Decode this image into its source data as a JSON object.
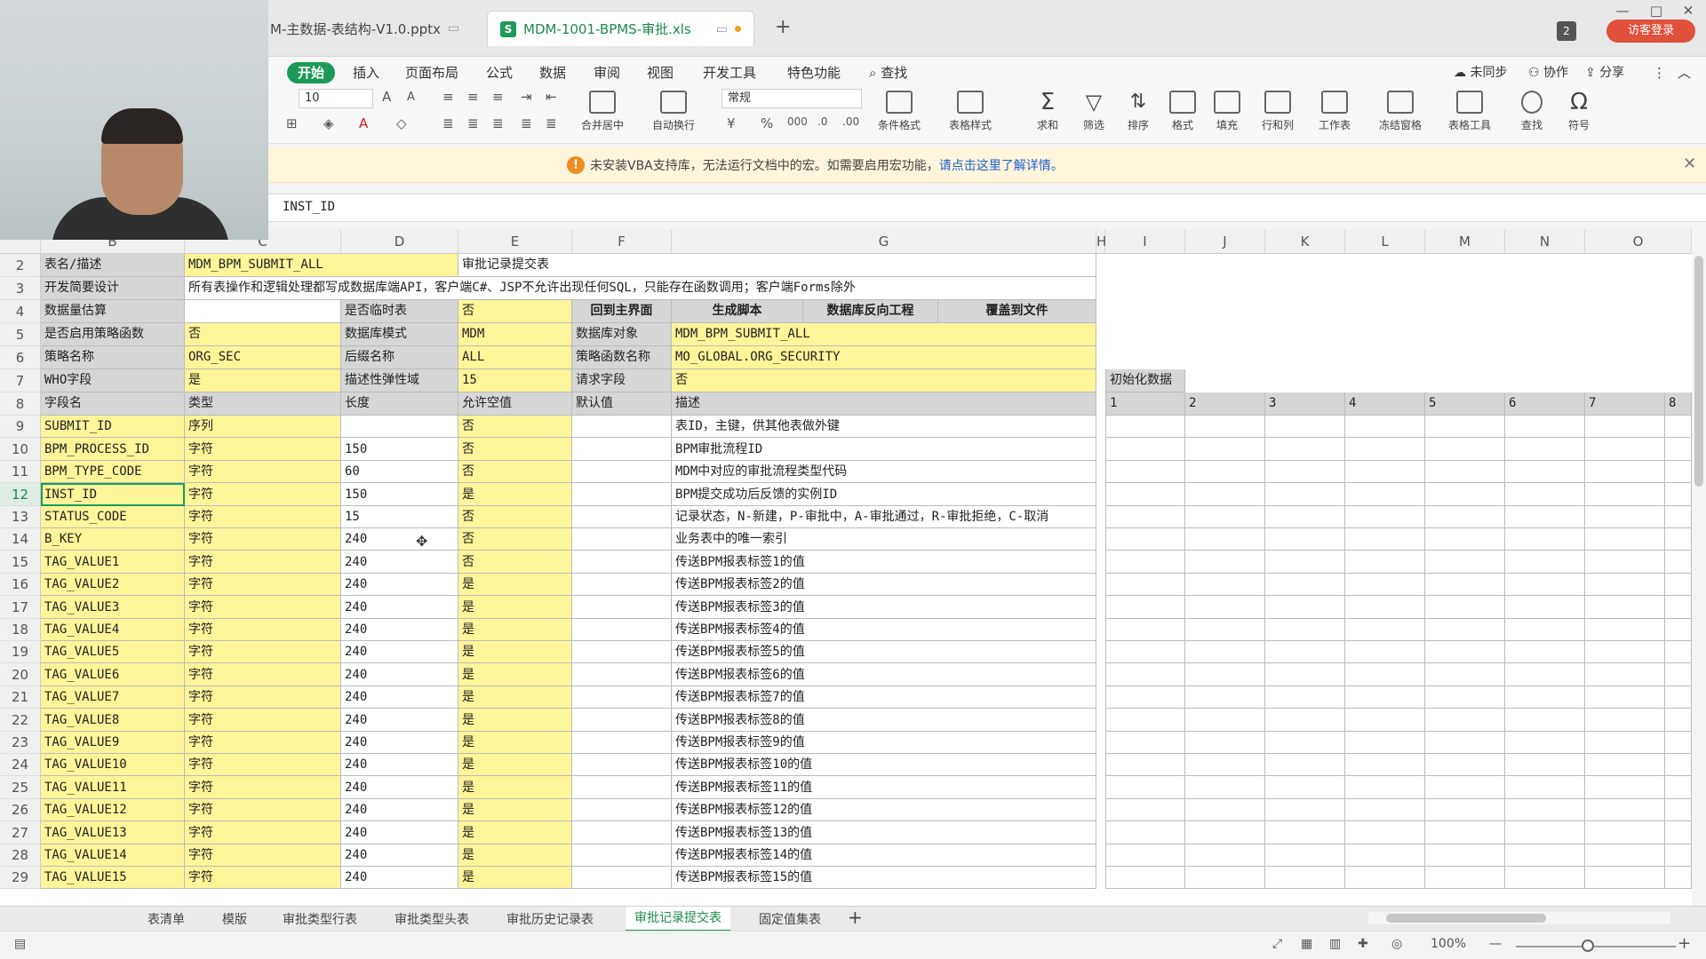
{
  "tabs": [
    {
      "label": "M-主数据-表结构-V1.0.pptx",
      "active": false
    },
    {
      "label": "MDM-1001-BPMS-审批.xls",
      "active": true
    }
  ],
  "window": {
    "badge": "2",
    "login": "访客登录"
  },
  "menu": {
    "items": [
      "开始",
      "插入",
      "页面布局",
      "公式",
      "数据",
      "审阅",
      "视图",
      "开发工具",
      "特色功能"
    ],
    "search": "查找",
    "sync": "未同步",
    "collab": "协作",
    "share": "分享"
  },
  "toolbar": {
    "font_size": "10",
    "number_format": "常规",
    "merge_label": "合并居中",
    "wrap_label": "自动换行",
    "buttons": [
      "条件格式",
      "表格样式",
      "求和",
      "筛选",
      "排序",
      "格式",
      "填充",
      "行和列",
      "工作表",
      "冻结窗格",
      "表格工具",
      "查找",
      "符号"
    ]
  },
  "notice": {
    "text": "未安装VBA支持库，无法运行文档中的宏。如需要启用宏功能，",
    "link": "请点击这里了解详情。"
  },
  "formula_bar": {
    "value": "INST_ID"
  },
  "columns": [
    "B",
    "C",
    "D",
    "E",
    "F",
    "G",
    "H",
    "I",
    "J",
    "K",
    "L",
    "M",
    "N",
    "O"
  ],
  "header_block": {
    "r2": {
      "label": "表名/描述",
      "table": "MDM_BPM_SUBMIT_ALL",
      "desc": "审批记录提交表"
    },
    "r3": {
      "label": "开发简要设计",
      "text": "所有表操作和逻辑处理都写成数据库端API，客户端C#、JSP不允许出现任何SQL，只能存在函数调用；客户端Forms除外"
    },
    "r4": {
      "label": "数据量估算",
      "tmp_label": "是否临时表",
      "tmp_val": "否",
      "btn1": "回到主界面",
      "btn2": "生成脚本",
      "btn3": "数据库反向工程",
      "btn4": "覆盖到文件"
    },
    "r5": {
      "label": "是否启用策略函数",
      "val": "否",
      "mode_label": "数据库模式",
      "mode_val": "MDM",
      "obj_label": "数据库对象",
      "obj_val": "MDM_BPM_SUBMIT_ALL"
    },
    "r6": {
      "label": "策略名称",
      "val": "ORG_SEC",
      "suffix_label": "后缀名称",
      "suffix_val": "ALL",
      "fn_label": "策略函数名称",
      "fn_val": "MO_GLOBAL.ORG_SECURITY"
    },
    "r7": {
      "label": "WHO字段",
      "val": "是",
      "flex_label": "描述性弹性域",
      "flex_val": "15",
      "req_label": "请求字段",
      "req_val": "否",
      "init_label": "初始化数据"
    },
    "r8": {
      "h1": "字段名",
      "h2": "类型",
      "h3": "长度",
      "h4": "允许空值",
      "h5": "默认值",
      "h6": "描述",
      "nums": [
        "1",
        "2",
        "3",
        "4",
        "5",
        "6",
        "7",
        "8"
      ]
    }
  },
  "rows": [
    {
      "n": "9",
      "name": "SUBMIT_ID",
      "type": "序列",
      "len": "",
      "nullable": "否",
      "desc": "表ID，主键，供其他表做外键"
    },
    {
      "n": "10",
      "name": "BPM_PROCESS_ID",
      "type": "字符",
      "len": "150",
      "nullable": "否",
      "desc": "BPM审批流程ID"
    },
    {
      "n": "11",
      "name": "BPM_TYPE_CODE",
      "type": "字符",
      "len": "60",
      "nullable": "否",
      "desc": "MDM中对应的审批流程类型代码"
    },
    {
      "n": "12",
      "name": "INST_ID",
      "type": "字符",
      "len": "150",
      "nullable": "是",
      "desc": "BPM提交成功后反馈的实例ID"
    },
    {
      "n": "13",
      "name": "STATUS_CODE",
      "type": "字符",
      "len": "15",
      "nullable": "否",
      "desc": "记录状态，N-新建，P-审批中，A-审批通过，R-审批拒绝，C-取消"
    },
    {
      "n": "14",
      "name": "B_KEY",
      "type": "字符",
      "len": "240",
      "nullable": "否",
      "desc": "业务表中的唯一索引"
    },
    {
      "n": "15",
      "name": "TAG_VALUE1",
      "type": "字符",
      "len": "240",
      "nullable": "否",
      "desc": "传送BPM报表标签1的值"
    },
    {
      "n": "16",
      "name": "TAG_VALUE2",
      "type": "字符",
      "len": "240",
      "nullable": "是",
      "desc": "传送BPM报表标签2的值"
    },
    {
      "n": "17",
      "name": "TAG_VALUE3",
      "type": "字符",
      "len": "240",
      "nullable": "是",
      "desc": "传送BPM报表标签3的值"
    },
    {
      "n": "18",
      "name": "TAG_VALUE4",
      "type": "字符",
      "len": "240",
      "nullable": "是",
      "desc": "传送BPM报表标签4的值"
    },
    {
      "n": "19",
      "name": "TAG_VALUE5",
      "type": "字符",
      "len": "240",
      "nullable": "是",
      "desc": "传送BPM报表标签5的值"
    },
    {
      "n": "20",
      "name": "TAG_VALUE6",
      "type": "字符",
      "len": "240",
      "nullable": "是",
      "desc": "传送BPM报表标签6的值"
    },
    {
      "n": "21",
      "name": "TAG_VALUE7",
      "type": "字符",
      "len": "240",
      "nullable": "是",
      "desc": "传送BPM报表标签7的值"
    },
    {
      "n": "22",
      "name": "TAG_VALUE8",
      "type": "字符",
      "len": "240",
      "nullable": "是",
      "desc": "传送BPM报表标签8的值"
    },
    {
      "n": "23",
      "name": "TAG_VALUE9",
      "type": "字符",
      "len": "240",
      "nullable": "是",
      "desc": "传送BPM报表标签9的值"
    },
    {
      "n": "24",
      "name": "TAG_VALUE10",
      "type": "字符",
      "len": "240",
      "nullable": "是",
      "desc": "传送BPM报表标签10的值"
    },
    {
      "n": "25",
      "name": "TAG_VALUE11",
      "type": "字符",
      "len": "240",
      "nullable": "是",
      "desc": "传送BPM报表标签11的值"
    },
    {
      "n": "26",
      "name": "TAG_VALUE12",
      "type": "字符",
      "len": "240",
      "nullable": "是",
      "desc": "传送BPM报表标签12的值"
    },
    {
      "n": "27",
      "name": "TAG_VALUE13",
      "type": "字符",
      "len": "240",
      "nullable": "是",
      "desc": "传送BPM报表标签13的值"
    },
    {
      "n": "28",
      "name": "TAG_VALUE14",
      "type": "字符",
      "len": "240",
      "nullable": "是",
      "desc": "传送BPM报表标签14的值"
    },
    {
      "n": "29",
      "name": "TAG_VALUE15",
      "type": "字符",
      "len": "240",
      "nullable": "是",
      "desc": "传送BPM报表标签15的值"
    }
  ],
  "sheets": [
    "表清单",
    "模版",
    "审批类型行表",
    "审批类型头表",
    "审批历史记录表",
    "审批记录提交表",
    "固定值集表"
  ],
  "active_sheet": "审批记录提交表",
  "status": {
    "zoom": "100%"
  }
}
